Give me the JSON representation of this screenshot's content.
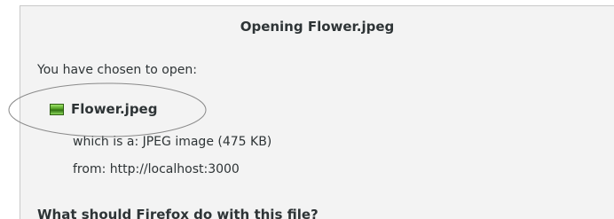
{
  "dialog": {
    "title": "Opening Flower.jpeg",
    "intro": "You have chosen to open:",
    "file": {
      "icon": "image-file-icon",
      "name": "Flower.jpeg"
    },
    "type_line": "which is a:  JPEG image (475 KB)",
    "from_line": "from: http://localhost:3000",
    "question": "What should Firefox do with this file?"
  }
}
